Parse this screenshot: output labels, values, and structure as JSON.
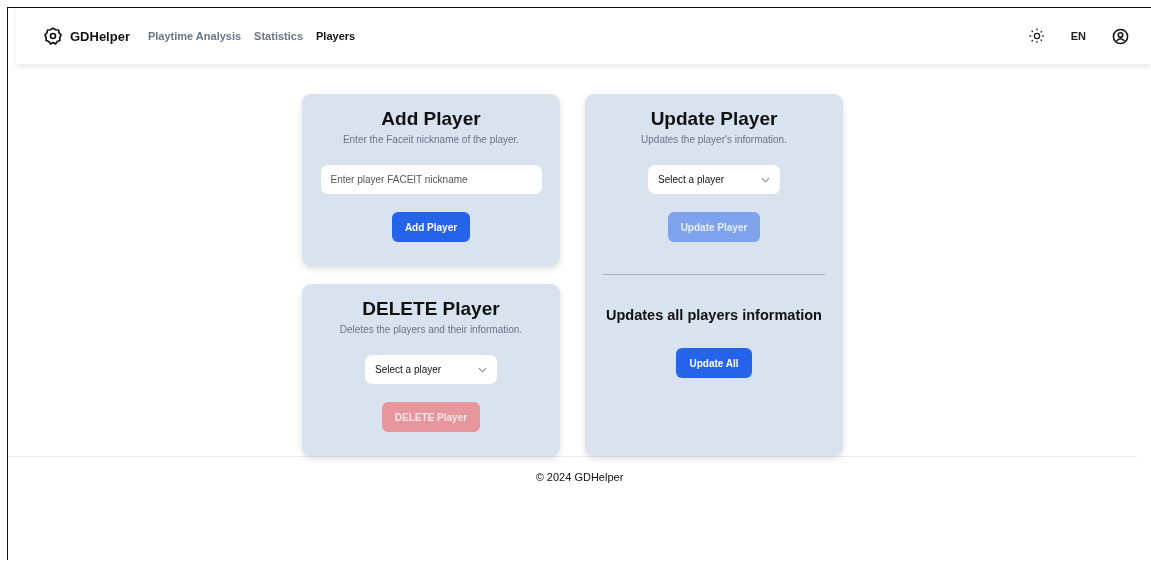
{
  "brand": "GDHelper",
  "nav": [
    {
      "label": "Playtime Analysis",
      "selected": false
    },
    {
      "label": "Statistics",
      "selected": false
    },
    {
      "label": "Players",
      "selected": true
    }
  ],
  "language": "EN",
  "add_card": {
    "title": "Add Player",
    "subtitle": "Enter the Faceit nickname of the player.",
    "input": {
      "placeholder": "Enter player FACEIT nickname"
    },
    "button": {
      "label": "Add Player",
      "disabled": false
    }
  },
  "delete_card": {
    "title": "DELETE Player",
    "subtitle": "Deletes the players and their information.",
    "select": {
      "value": "Select a player"
    },
    "button": {
      "label": "DELETE Player",
      "disabled": true
    }
  },
  "update_card": {
    "title": "Update Player",
    "subtitle": "Updates the player's information.",
    "select": {
      "value": "Select a player"
    },
    "button": {
      "label": "Update Player",
      "disabled": true
    },
    "all_title": "Updates all players information",
    "all_button": {
      "label": "Update All",
      "disabled": false
    }
  },
  "footer": "© 2024 GDHelper"
}
